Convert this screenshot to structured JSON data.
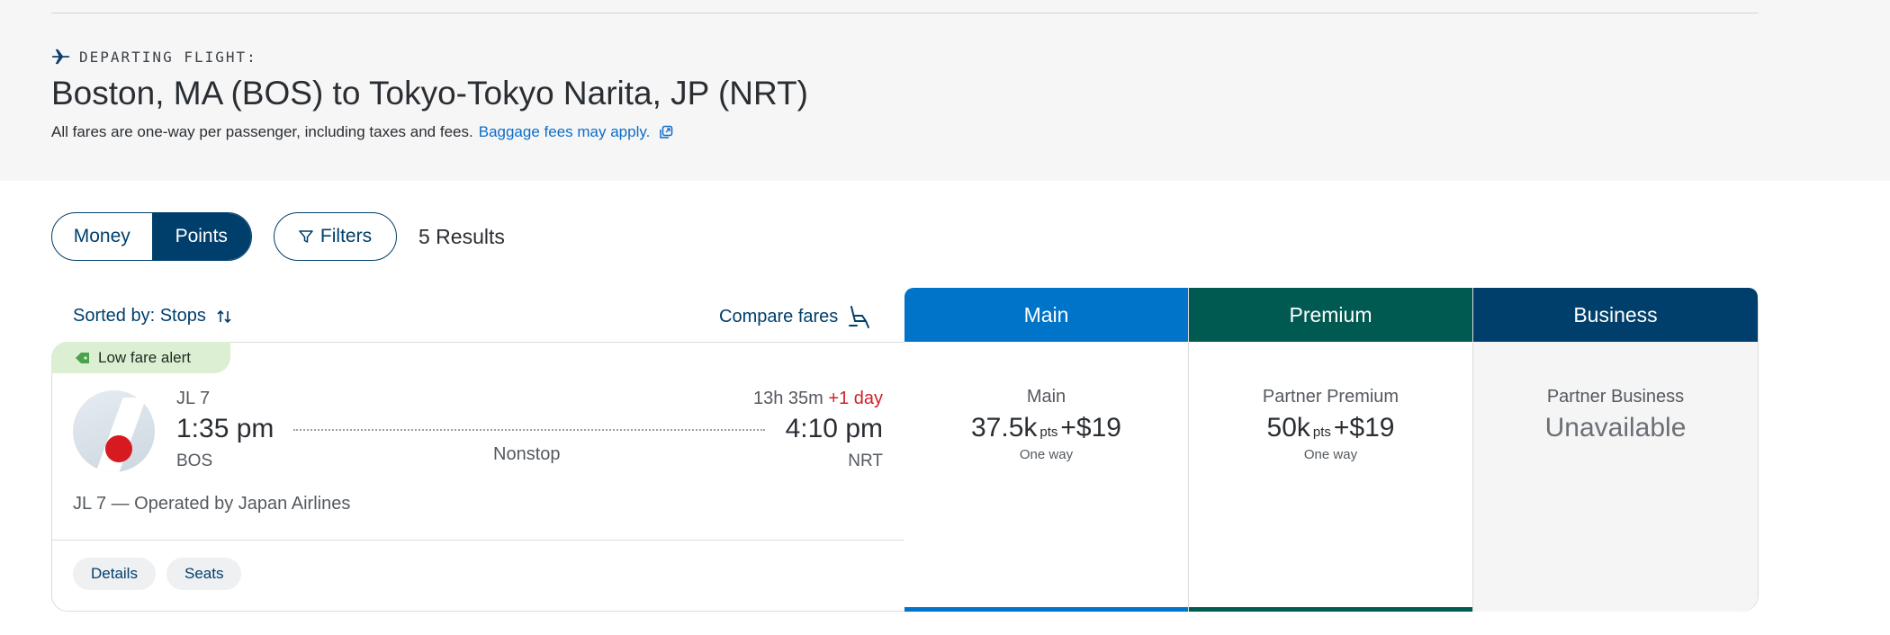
{
  "header": {
    "departing_label": "DEPARTING FLIGHT:",
    "route": "Boston, MA (BOS) to Tokyo-Tokyo Narita, JP (NRT)",
    "fares_note": "All fares are one-way per passenger, including taxes and fees.",
    "baggage_link": "Baggage fees may apply."
  },
  "controls": {
    "money": "Money",
    "points": "Points",
    "active": "points",
    "filters": "Filters",
    "results": "5 Results",
    "sorted_by": "Sorted by: Stops",
    "compare": "Compare fares"
  },
  "flight": {
    "alert": "Low fare alert",
    "number": "JL 7",
    "departure_time": "1:35 pm",
    "departure_code": "BOS",
    "arrival_time": "4:10 pm",
    "arrival_code": "NRT",
    "duration": "13h 35m",
    "plus_day": "+1 day",
    "stops": "Nonstop",
    "operated": "JL 7 — Operated by Japan Airlines",
    "details": "Details",
    "seats": "Seats"
  },
  "fare_columns": [
    {
      "header": "Main",
      "color": "#0074c8",
      "fare_name": "Main",
      "points": "37.5k",
      "pts_unit": "pts",
      "cash": "+$19",
      "note": "One way"
    },
    {
      "header": "Premium",
      "color": "#005a51",
      "fare_name": "Partner Premium",
      "points": "50k",
      "pts_unit": "pts",
      "cash": "+$19",
      "note": "One way"
    },
    {
      "header": "Business",
      "color": "#003f6b",
      "fare_name": "Partner Business",
      "status": "Unavailable"
    }
  ]
}
